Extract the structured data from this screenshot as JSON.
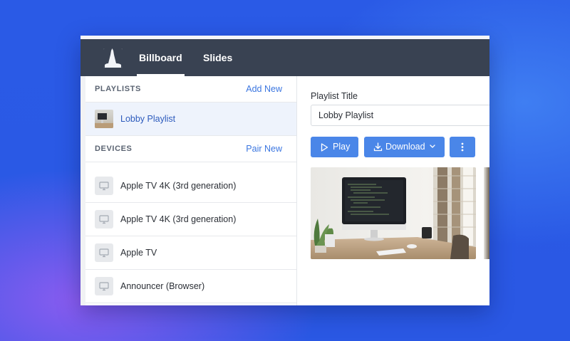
{
  "nav": {
    "tabs": [
      {
        "label": "Billboard",
        "active": true
      },
      {
        "label": "Slides",
        "active": false
      }
    ]
  },
  "sidebar": {
    "playlists": {
      "title": "PLAYLISTS",
      "action": "Add New",
      "items": [
        {
          "label": "Lobby Playlist",
          "selected": true
        }
      ]
    },
    "devices": {
      "title": "DEVICES",
      "action": "Pair New",
      "items": [
        {
          "label": "Apple TV 4K (3rd generation)",
          "icon": "tv-icon"
        },
        {
          "label": "Apple TV 4K (3rd generation)",
          "icon": "tv-icon"
        },
        {
          "label": "Apple TV",
          "icon": "tv-icon"
        },
        {
          "label": "Announcer (Browser)",
          "icon": "tv-icon"
        }
      ]
    }
  },
  "main": {
    "field_label": "Playlist Title",
    "title_value": "Lobby Playlist",
    "buttons": {
      "play": "Play",
      "download": "Download"
    }
  },
  "colors": {
    "navbar": "#394252",
    "accent": "#4a86e8",
    "link": "#3b76e0",
    "selected_row": "#eef3fc",
    "background": "#2a58e4"
  }
}
